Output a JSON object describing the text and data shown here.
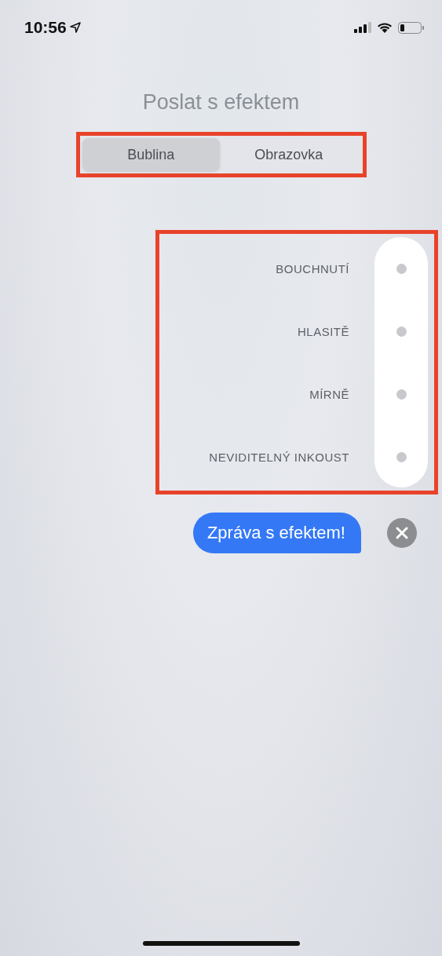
{
  "status_bar": {
    "time": "10:56"
  },
  "title": "Poslat s efektem",
  "tabs": [
    {
      "label": "Bublina",
      "selected": true
    },
    {
      "label": "Obrazovka",
      "selected": false
    }
  ],
  "effects": [
    {
      "label": "BOUCHNUTÍ",
      "selected": false
    },
    {
      "label": "HLASITĚ",
      "selected": false
    },
    {
      "label": "MÍRNĚ",
      "selected": false
    },
    {
      "label": "NEVIDITELNÝ INKOUST",
      "selected": false
    }
  ],
  "message": {
    "text": "Zpráva s efektem!"
  }
}
